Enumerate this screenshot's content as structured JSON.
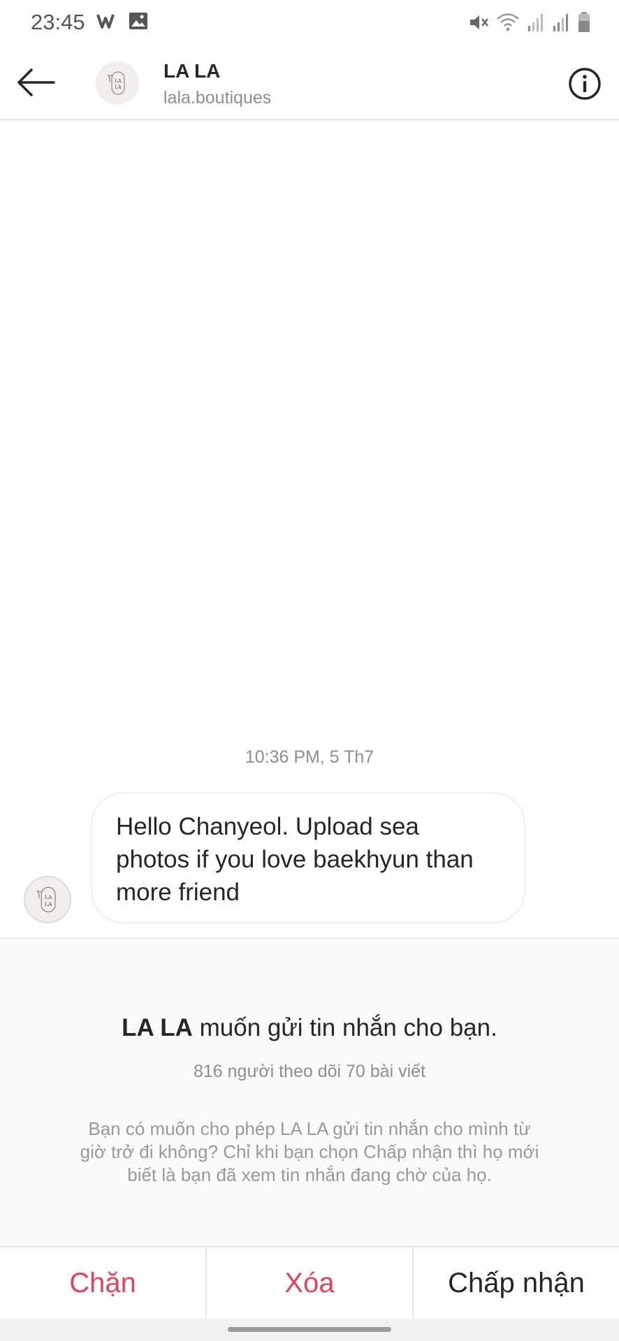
{
  "status_bar": {
    "time": "23:45",
    "left_icons": [
      "w-app-icon",
      "image-icon"
    ],
    "right_icons": [
      "mute-icon",
      "wifi-icon",
      "signal-icon",
      "signal-icon",
      "battery-icon"
    ]
  },
  "header": {
    "title": "LA LA",
    "subtitle": "lala.boutiques",
    "avatar_logo": "LA LA"
  },
  "thread": {
    "timestamp": "10:36 PM, 5 Th7",
    "messages": [
      {
        "line1": "Hello Chanyeol. Upload sea",
        "line2": "photos if you love baekhyun than",
        "line3": "more friend"
      }
    ]
  },
  "request": {
    "sender": "LA LA",
    "title_rest": " muốn gửi tin nhắn cho bạn.",
    "stats": "816 người theo dõi 70 bài viết",
    "desc_line1": "Bạn có muốn cho phép LA LA gửi tin nhắn cho mình từ",
    "desc_line2": "giờ trở đi không? Chỉ khi bạn chọn Chấp nhận thì họ mới",
    "desc_line3": "biết là bạn đã xem tin nhắn đang chờ của họ."
  },
  "actions": {
    "block": "Chặn",
    "delete": "Xóa",
    "accept": "Chấp nhận"
  },
  "colors": {
    "danger": "#e0445a",
    "text": "#262626",
    "muted": "#8e8e8e"
  }
}
